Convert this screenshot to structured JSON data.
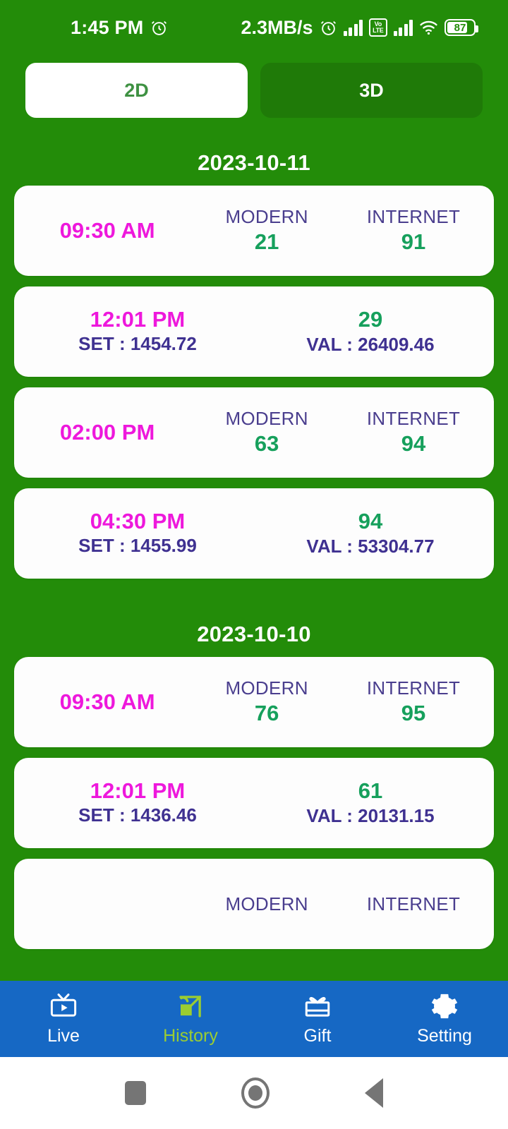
{
  "status_bar": {
    "time": "1:45 PM",
    "alarm_icon": "alarm-clock-icon",
    "network_speed": "2.3MB/s",
    "volte_label": "Vo\nLTE",
    "volte_line1": "Vo",
    "volte_line2": "LTE",
    "battery_percent": "87"
  },
  "tabs": [
    {
      "label": "2D",
      "active": true
    },
    {
      "label": "3D",
      "active": false
    }
  ],
  "colors": {
    "background_green": "#238C09",
    "tab_inactive_green": "#1F7A08",
    "tab_active_text": "#3E9142",
    "time_magenta": "#EE18DC",
    "value_green": "#16A05C",
    "label_purple": "#4A3E8E",
    "setval_purple": "#3F3191",
    "nav_blue": "#1668C4",
    "nav_active": "#9ACD32",
    "card_white": "#FDFDFD"
  },
  "sections": [
    {
      "date": "2023-10-11",
      "rows": [
        {
          "type": "labeled",
          "time": "09:30 AM",
          "mid_label": "MODERN",
          "mid_value": "21",
          "end_label": "INTERNET",
          "end_value": "91"
        },
        {
          "type": "setval",
          "time": "12:01 PM",
          "set_text": "SET : 1454.72",
          "end_value": "29",
          "val_text": "VAL : 26409.46"
        },
        {
          "type": "labeled",
          "time": "02:00 PM",
          "mid_label": "MODERN",
          "mid_value": "63",
          "end_label": "INTERNET",
          "end_value": "94"
        },
        {
          "type": "setval",
          "time": "04:30 PM",
          "set_text": "SET : 1455.99",
          "end_value": "94",
          "val_text": "VAL : 53304.77"
        }
      ]
    },
    {
      "date": "2023-10-10",
      "rows": [
        {
          "type": "labeled",
          "time": "09:30 AM",
          "mid_label": "MODERN",
          "mid_value": "76",
          "end_label": "INTERNET",
          "end_value": "95"
        },
        {
          "type": "setval",
          "time": "12:01 PM",
          "set_text": "SET : 1436.46",
          "end_value": "61",
          "val_text": "VAL : 20131.15"
        },
        {
          "type": "labeled",
          "time": "",
          "mid_label": "MODERN",
          "mid_value": "",
          "end_label": "INTERNET",
          "end_value": ""
        }
      ]
    }
  ],
  "bottom_nav": [
    {
      "label": "Live",
      "icon": "tv-play-icon",
      "active": false
    },
    {
      "label": "History",
      "icon": "history-edit-icon",
      "active": true
    },
    {
      "label": "Gift",
      "icon": "gift-box-icon",
      "active": false
    },
    {
      "label": "Setting",
      "icon": "gear-icon",
      "active": false
    }
  ],
  "system_nav": {
    "recents": "square-recents-icon",
    "home": "circle-home-icon",
    "back": "triangle-back-icon"
  }
}
